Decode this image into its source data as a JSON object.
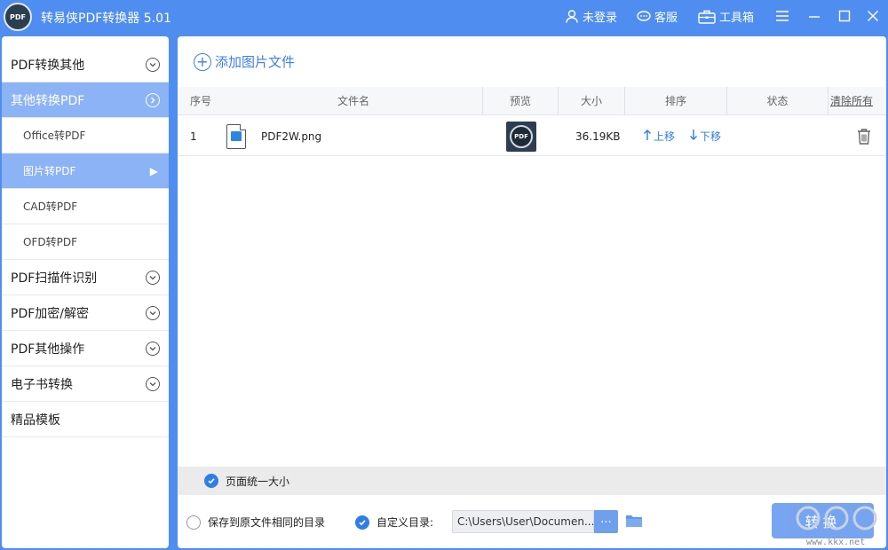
{
  "app": {
    "title": "转易侠PDF转换器 5.01",
    "logo_text": "PDF"
  },
  "toolbar": {
    "login": "未登录",
    "service": "客服",
    "toolbox": "工具箱"
  },
  "sidebar": {
    "items": [
      {
        "label": "PDF转换其他"
      },
      {
        "label": "其他转换PDF"
      },
      {
        "label": "Office转PDF"
      },
      {
        "label": "图片转PDF"
      },
      {
        "label": "CAD转PDF"
      },
      {
        "label": "OFD转PDF"
      },
      {
        "label": "PDF扫描件识别"
      },
      {
        "label": "PDF加密/解密"
      },
      {
        "label": "PDF其他操作"
      },
      {
        "label": "电子书转换"
      },
      {
        "label": "精品模板"
      }
    ]
  },
  "main": {
    "add_label": "添加图片文件",
    "columns": {
      "index": "序号",
      "filename": "文件名",
      "preview": "预览",
      "size": "大小",
      "sort": "排序",
      "status": "状态",
      "clear_all": "清除所有"
    },
    "rows": [
      {
        "index": "1",
        "filename": "PDF2W.png",
        "preview_text": "PDF",
        "size": "36.19KB",
        "move_up": "上移",
        "move_down": "下移",
        "status": ""
      }
    ]
  },
  "options": {
    "uniform_size": "页面统一大小",
    "save_same_dir": "保存到原文件相同的目录",
    "custom_dir_label": "自定义目录:",
    "custom_dir_value": "C:\\Users\\User\\Documen...",
    "browse": "...",
    "convert": "转换"
  },
  "watermark": {
    "url": "www.kkx.net"
  },
  "colors": {
    "accent": "#4f8ef0",
    "sidebar_active": "#8cb3f5",
    "link": "#2e7ce6"
  }
}
